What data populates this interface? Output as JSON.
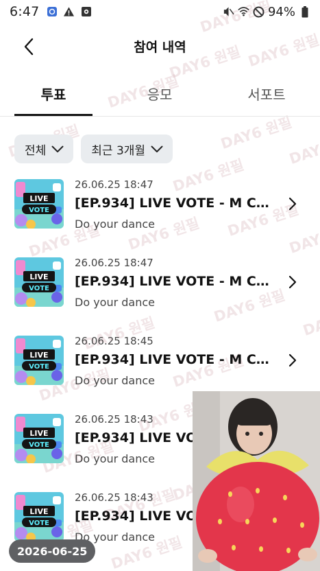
{
  "status_bar": {
    "time": "6:47",
    "battery": "94%"
  },
  "header": {
    "title": "참여 내역"
  },
  "tabs": [
    {
      "label": "투표",
      "active": true
    },
    {
      "label": "응모",
      "active": false
    },
    {
      "label": "서포트",
      "active": false
    }
  ],
  "filters": {
    "type": "전체",
    "period": "최근 3개월"
  },
  "thumbnail_text": {
    "line1": "LIVE",
    "line2": "VOTE"
  },
  "items": [
    {
      "date": "26.06.25 18:47",
      "title": "[EP.934] LIVE VOTE - M CO...",
      "subtitle": "Do your dance"
    },
    {
      "date": "26.06.25 18:47",
      "title": "[EP.934] LIVE VOTE - M CO...",
      "subtitle": "Do your dance"
    },
    {
      "date": "26.06.25 18:45",
      "title": "[EP.934] LIVE VOTE - M CO...",
      "subtitle": "Do your dance"
    },
    {
      "date": "26.06.25 18:43",
      "title": "[EP.934] LIVE VOTE - M CO...",
      "subtitle": "Do your dance"
    },
    {
      "date": "26.06.25 18:43",
      "title": "[EP.934] LIVE VOTE - M CO...",
      "subtitle": "Do your dance"
    }
  ],
  "watermark": "DAY6 원필",
  "date_badge": "2026-06-25",
  "colors": {
    "accent": "#111111",
    "chip_bg": "#e9ecef",
    "thumb_bg": "#5ec8e0",
    "watermark": "#cda0aa"
  }
}
